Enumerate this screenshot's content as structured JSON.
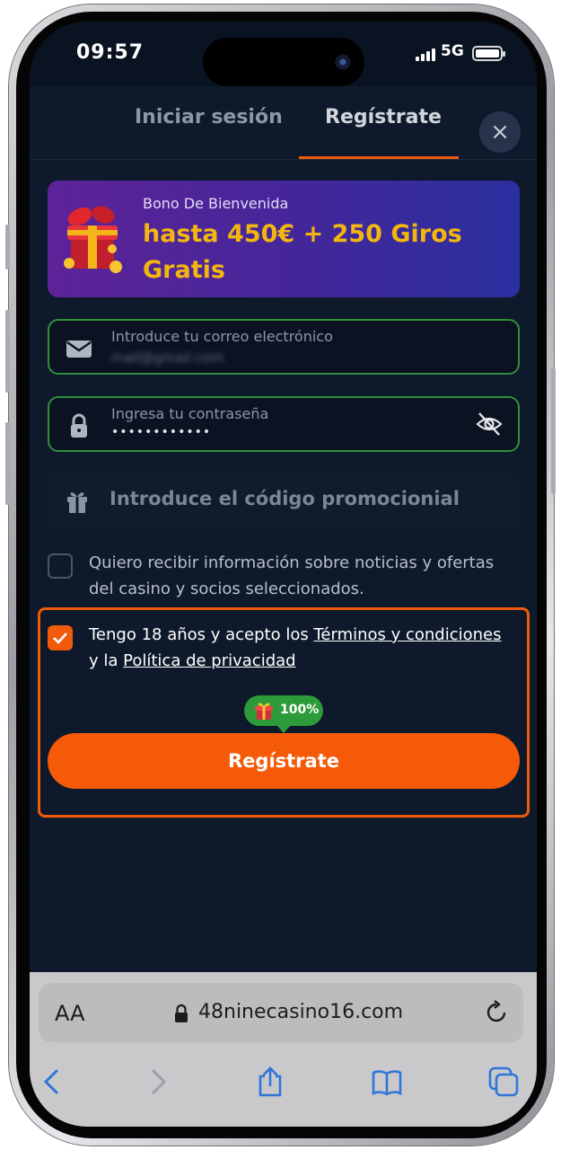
{
  "status_bar": {
    "time": "09:57",
    "network": "5G"
  },
  "tabs": {
    "login": "Iniciar sesión",
    "register": "Regístrate",
    "close": "×"
  },
  "promo": {
    "subtitle": "Bono De Bienvenida",
    "title": "hasta 450€ + 250 Giros Gratis"
  },
  "email": {
    "label": "Introduce tu correo electrónico",
    "value": "mail@gmail.com"
  },
  "password": {
    "label": "Ingresa tu contraseña",
    "value": "••••••••••••"
  },
  "promo_code": {
    "placeholder": "Introduce el código promocionial"
  },
  "newsletter": {
    "checked": false,
    "text": "Quiero recibir información sobre noticias y ofertas del casino y socios seleccionados."
  },
  "terms": {
    "checked": true,
    "text_before": "Tengo 18 años y acepto los ",
    "terms_link": "Términos y condiciones",
    "text_middle": " y la ",
    "privacy_link": "Política de privacidad"
  },
  "bonus_badge": {
    "text": "100%"
  },
  "register_button": {
    "label": "Regístrate"
  },
  "browser": {
    "aa_label": "AA",
    "url": "48ninecasino16.com"
  },
  "colors": {
    "accent": "#f45a08",
    "success": "#2e9b3a",
    "background": "#0e1a2c",
    "promo_text": "#f3b60f"
  }
}
